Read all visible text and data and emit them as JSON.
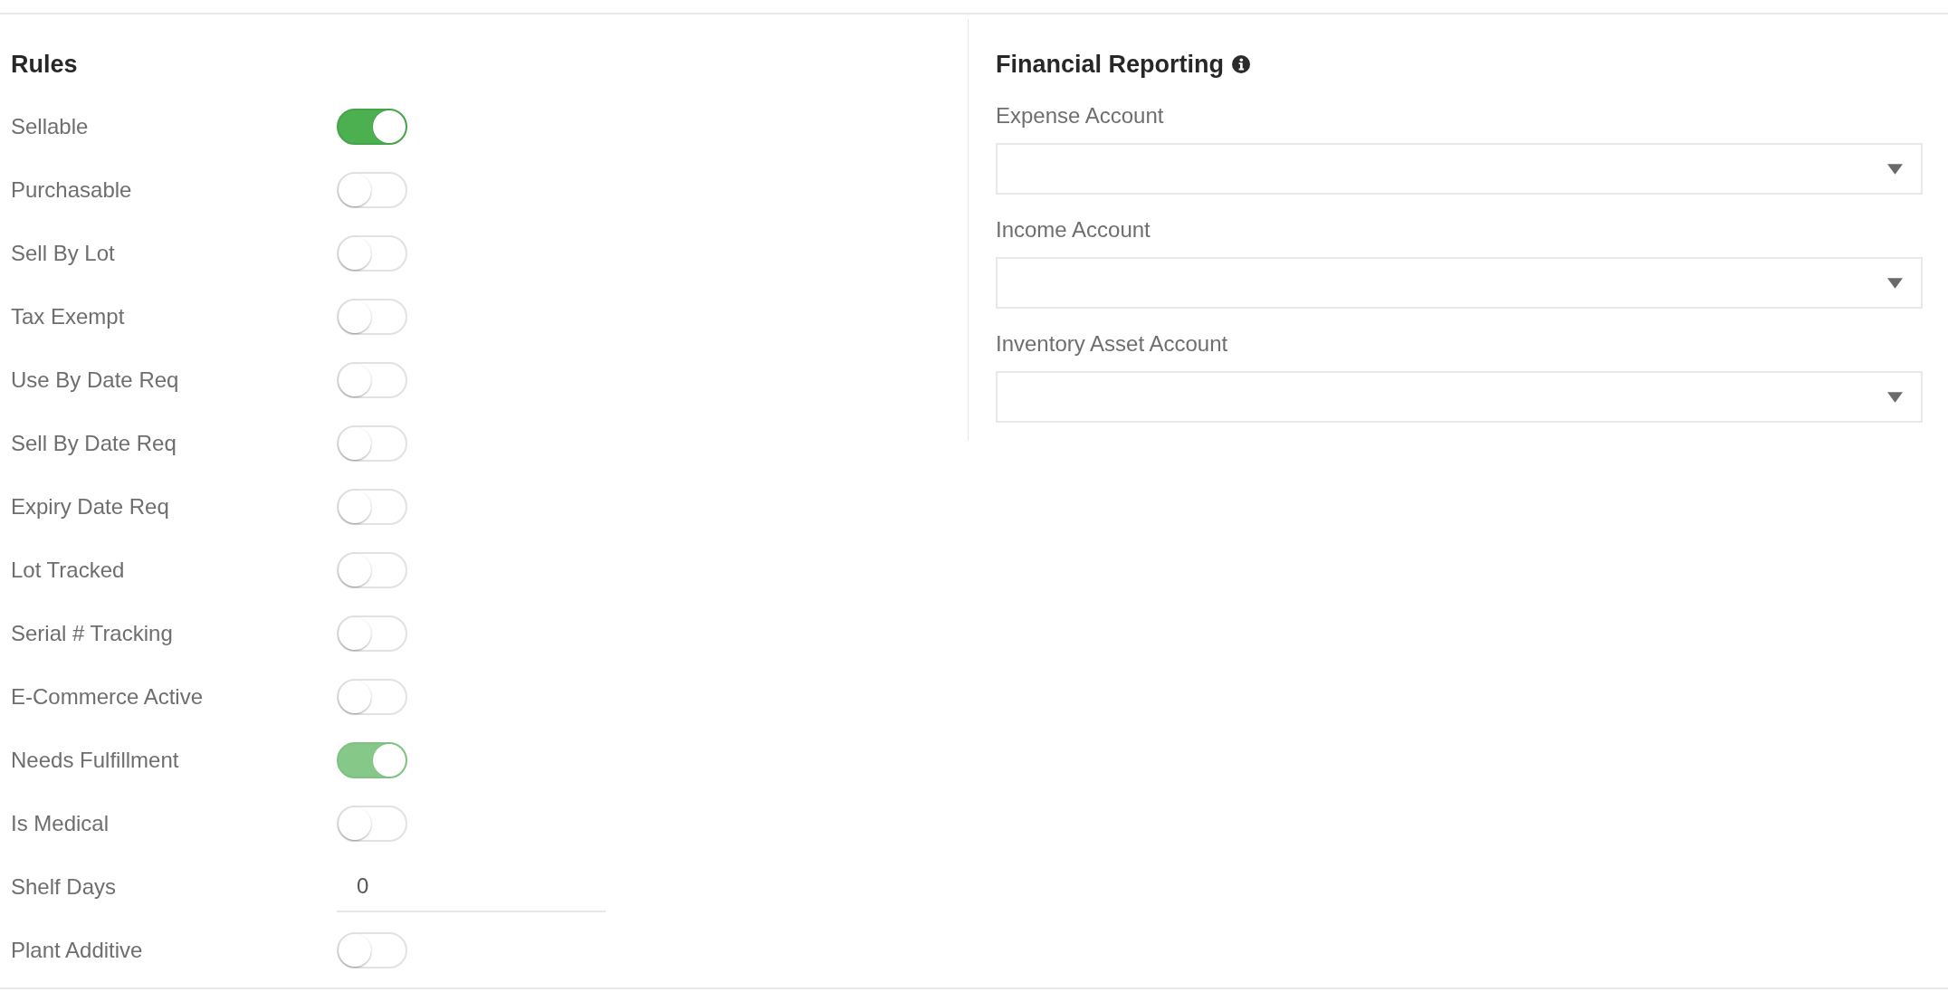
{
  "rules": {
    "title": "Rules",
    "items": [
      {
        "kind": "toggle",
        "label": "Sellable",
        "on": true,
        "disabled": false
      },
      {
        "kind": "toggle",
        "label": "Purchasable",
        "on": false,
        "disabled": false
      },
      {
        "kind": "toggle",
        "label": "Sell By Lot",
        "on": false,
        "disabled": false
      },
      {
        "kind": "toggle",
        "label": "Tax Exempt",
        "on": false,
        "disabled": false
      },
      {
        "kind": "toggle",
        "label": "Use By Date Req",
        "on": false,
        "disabled": false
      },
      {
        "kind": "toggle",
        "label": "Sell By Date Req",
        "on": false,
        "disabled": false
      },
      {
        "kind": "toggle",
        "label": "Expiry Date Req",
        "on": false,
        "disabled": false
      },
      {
        "kind": "toggle",
        "label": "Lot Tracked",
        "on": false,
        "disabled": false
      },
      {
        "kind": "toggle",
        "label": "Serial # Tracking",
        "on": false,
        "disabled": false
      },
      {
        "kind": "toggle",
        "label": "E-Commerce Active",
        "on": false,
        "disabled": false
      },
      {
        "kind": "toggle",
        "label": "Needs Fulfillment",
        "on": true,
        "disabled": true
      },
      {
        "kind": "toggle",
        "label": "Is Medical",
        "on": false,
        "disabled": false
      },
      {
        "kind": "number",
        "label": "Shelf Days",
        "value": "0"
      },
      {
        "kind": "toggle",
        "label": "Plant Additive",
        "on": false,
        "disabled": false
      }
    ]
  },
  "financial_reporting": {
    "title": "Financial Reporting",
    "fields": [
      {
        "label": "Expense Account"
      },
      {
        "label": "Income Account"
      },
      {
        "label": "Inventory Asset Account"
      }
    ]
  }
}
